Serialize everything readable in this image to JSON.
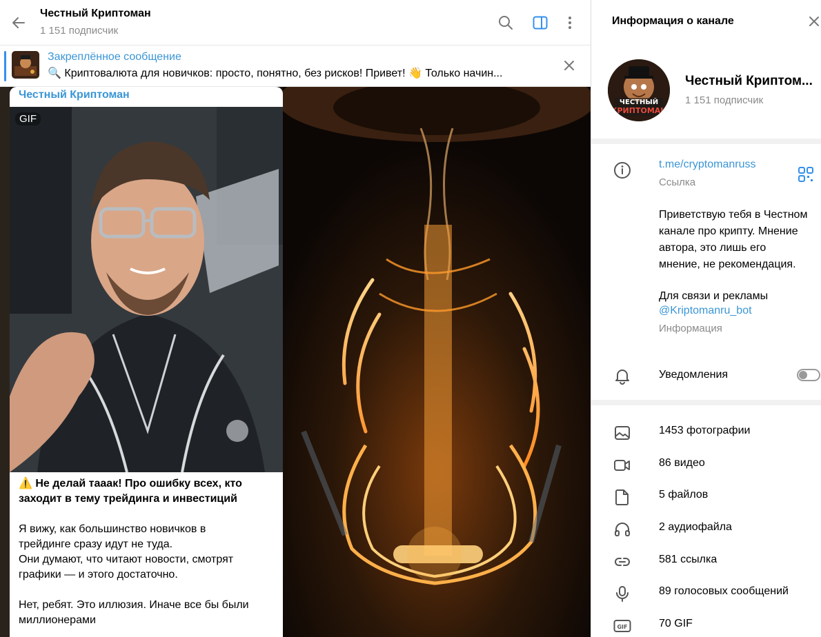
{
  "header": {
    "title": "Честный Криптоман",
    "subtitle": "1 151 подписчик"
  },
  "pinned": {
    "title": "Закреплённое сообщение",
    "text": "🔍 Криптовалюта для новичков: просто, понятно, без рисков!   Привет! 👋 Только начин..."
  },
  "message": {
    "author": "Честный Криптоман",
    "media_badge": "GIF",
    "headline_line1": "⚠️ Не делай тааак! Про ошибку всех, кто",
    "headline_line2": "заходит в тему трейдинга и инвестиций",
    "para1_line1": "Я вижу, как большинство новичков в",
    "para1_line2": "трейдинге сразу идут не туда.",
    "para1_line3": "Они думают, что читают новости, смотрят",
    "para1_line4": "графики — и этого достаточно.",
    "para2_line1": "Нет, ребят. Это иллюзия. Иначе все бы были",
    "para2_line2": "миллионерами"
  },
  "info": {
    "title": "Информация о канале",
    "channel_name": "Честный Криптом...",
    "channel_sub": "1 151 подписчик",
    "avatar_text_line1": "ЧЕСТНЫЙ",
    "avatar_text_line2": "КРИПТОМАН",
    "link": "t.me/cryptomanruss",
    "link_caption": "Ссылка",
    "description_line1": "Приветствую тебя в Честном",
    "description_line2": "канале про крипту. Мнение",
    "description_line3": "автора, это лишь его",
    "description_line4": "мнение, не рекомендация.",
    "contact_text": "Для связи и рекламы",
    "contact_link": "@Kriptomanru_bot",
    "description_caption": "Информация",
    "notifications_label": "Уведомления",
    "notifications_on": false,
    "media": [
      {
        "icon": "photo-icon",
        "label": "1453 фотографии"
      },
      {
        "icon": "video-icon",
        "label": "86 видео"
      },
      {
        "icon": "file-icon",
        "label": "5 файлов"
      },
      {
        "icon": "headphones-icon",
        "label": "2 аудиофайла"
      },
      {
        "icon": "link-icon",
        "label": "581 ссылка"
      },
      {
        "icon": "microphone-icon",
        "label": "89 голосовых сообщений"
      },
      {
        "icon": "gif-icon",
        "label": "70 GIF"
      }
    ]
  },
  "colors": {
    "accent": "#3a95d5",
    "panel_accent": "#3390ec",
    "muted_text": "#8a8a8a",
    "separator": "#f1f1f1"
  }
}
